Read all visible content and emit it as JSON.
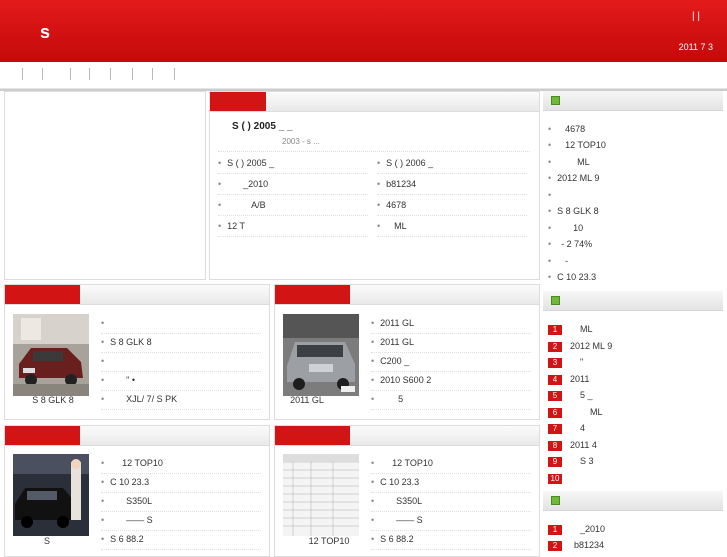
{
  "header": {
    "logo": "s",
    "links": "|   |",
    "date": "2011 7 3"
  },
  "feature": {
    "title": "S  (    ) 2005       _           _",
    "subtitle": "2003       -                                              s                 ...",
    "left_list": [
      "S ( ) 2005    _",
      "_2010",
      "A/B",
      "12       T"
    ],
    "right_list": [
      "S ( ) 2006    _",
      "b81234",
      "4678",
      "ML"
    ]
  },
  "section1": {
    "list": [
      "",
      "S     8     GLK     8",
      "",
      "\" •",
      "XJL/  7/  S PK"
    ],
    "caption": "S    8    GLK    8"
  },
  "section2": {
    "list": [
      "2011    GL",
      "2011    GL",
      "C200             _",
      "2010    S600      2",
      "5"
    ],
    "caption": "2011    GL"
  },
  "section3": {
    "list": [
      "12         TOP10",
      "C      10        23.3",
      "S350L",
      "——         S",
      "S      6          88.2"
    ],
    "caption": "S"
  },
  "section4": {
    "list": [
      "12         TOP10",
      "C      10        23.3",
      "S350L",
      "——         S",
      "S      6          88.2"
    ],
    "caption": "12        TOP10"
  },
  "right1": {
    "items": [
      "4678",
      "12       TOP10",
      "ML",
      "2012    ML       9",
      "",
      "S      8     GLK     8",
      "10",
      "-   2         74%",
      "-",
      "C       10        23.3"
    ]
  },
  "right2": {
    "items": [
      {
        "n": "1",
        "t": "ML"
      },
      {
        "n": "2",
        "t": "2012   ML       9"
      },
      {
        "n": "3",
        "t": "\""
      },
      {
        "n": "4",
        "t": "2011"
      },
      {
        "n": "5",
        "t": "5         _"
      },
      {
        "n": "6",
        "t": "ML"
      },
      {
        "n": "7",
        "t": "4"
      },
      {
        "n": "8",
        "t": "2011 4"
      },
      {
        "n": "9",
        "t": "S         3"
      },
      {
        "n": "10",
        "t": ""
      }
    ]
  },
  "right3": {
    "items": [
      {
        "n": "1",
        "t": "_2010"
      },
      {
        "n": "2",
        "t": "b81234"
      }
    ]
  },
  "colors": {
    "brand_red": "#d21414",
    "header_red": "#c40a0a",
    "icon_green": "#6fb83a"
  }
}
